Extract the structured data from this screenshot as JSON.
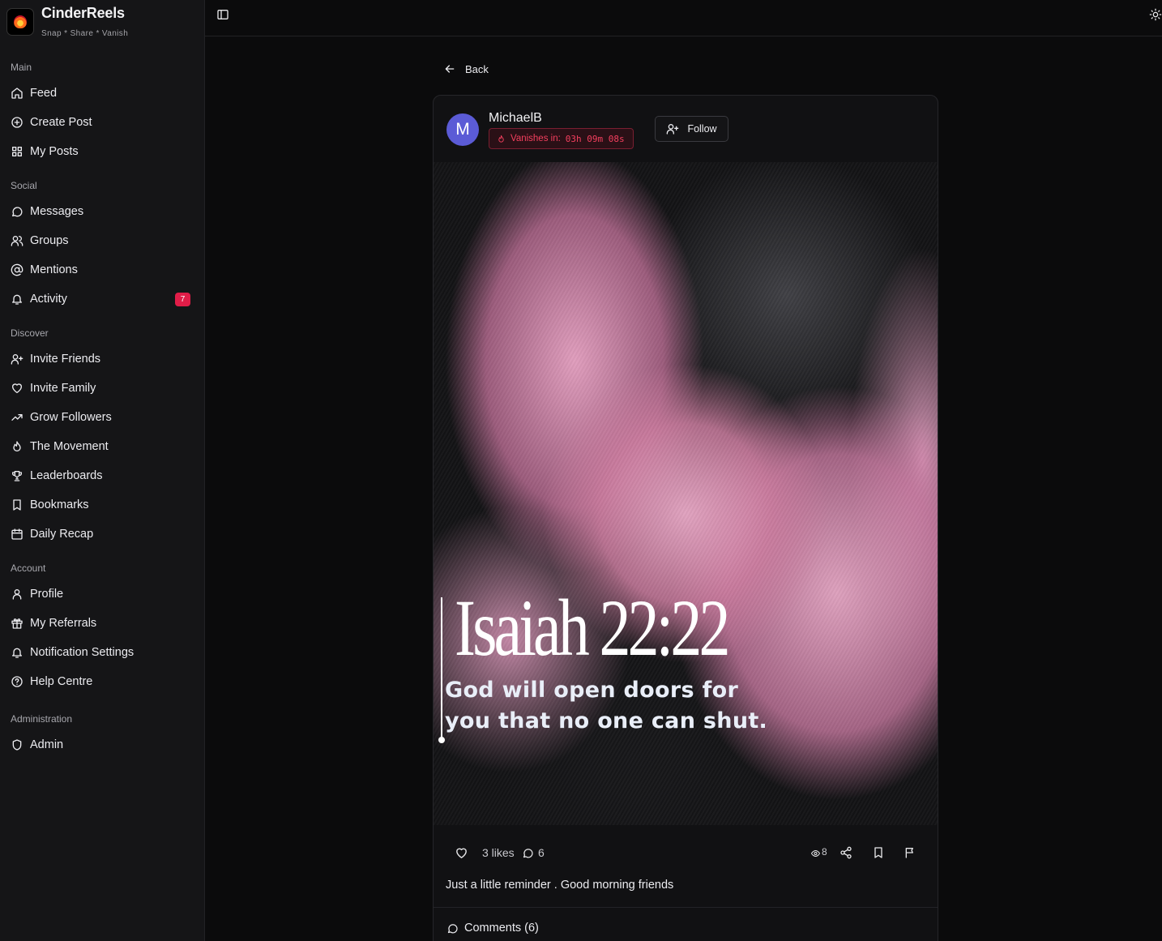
{
  "brand": {
    "name": "CinderReels",
    "tagline": "Snap * Share * Vanish"
  },
  "sidebar": {
    "sections": [
      {
        "label": "Main",
        "items": [
          {
            "label": "Feed",
            "icon": "home-icon"
          },
          {
            "label": "Create Post",
            "icon": "plus-circle-icon"
          },
          {
            "label": "My Posts",
            "icon": "grid-icon"
          }
        ]
      },
      {
        "label": "Social",
        "items": [
          {
            "label": "Messages",
            "icon": "message-icon"
          },
          {
            "label": "Groups",
            "icon": "users-icon"
          },
          {
            "label": "Mentions",
            "icon": "at-icon"
          },
          {
            "label": "Activity",
            "icon": "bell-icon",
            "badge": "7"
          }
        ]
      },
      {
        "label": "Discover",
        "items": [
          {
            "label": "Invite Friends",
            "icon": "user-plus-icon"
          },
          {
            "label": "Invite Family",
            "icon": "heart-icon"
          },
          {
            "label": "Grow Followers",
            "icon": "trending-up-icon"
          },
          {
            "label": "The Movement",
            "icon": "flame-icon"
          },
          {
            "label": "Leaderboards",
            "icon": "trophy-icon"
          },
          {
            "label": "Bookmarks",
            "icon": "bookmark-icon"
          },
          {
            "label": "Daily Recap",
            "icon": "calendar-icon"
          }
        ]
      },
      {
        "label": "Account",
        "items": [
          {
            "label": "Profile",
            "icon": "user-icon"
          },
          {
            "label": "My Referrals",
            "icon": "gift-icon"
          },
          {
            "label": "Notification Settings",
            "icon": "bell-icon"
          },
          {
            "label": "Help Centre",
            "icon": "help-circle-icon"
          }
        ]
      },
      {
        "label": "Administration",
        "items": [
          {
            "label": "Admin",
            "icon": "shield-icon"
          }
        ]
      }
    ]
  },
  "main": {
    "back_label": "Back",
    "post": {
      "author": "MichaelB",
      "avatar_letter": "M",
      "avatar_color": "#5b5bd6",
      "vanish_label": "Vanishes in:",
      "vanish_time": "03h 09m 08s",
      "follow_label": "Follow",
      "image_title": "Isaiah 22:22",
      "image_text": "God will open doors for you that no one can shut.",
      "likes_text": "3 likes",
      "comment_count": "6",
      "views": "8",
      "caption": "Just a little reminder . Good morning friends",
      "comments_label": "Comments (6)"
    }
  },
  "colors": {
    "accent": "#e11d48",
    "vanish": "#f43f5e",
    "background": "#0b0b0c",
    "sidebar": "#151517"
  }
}
